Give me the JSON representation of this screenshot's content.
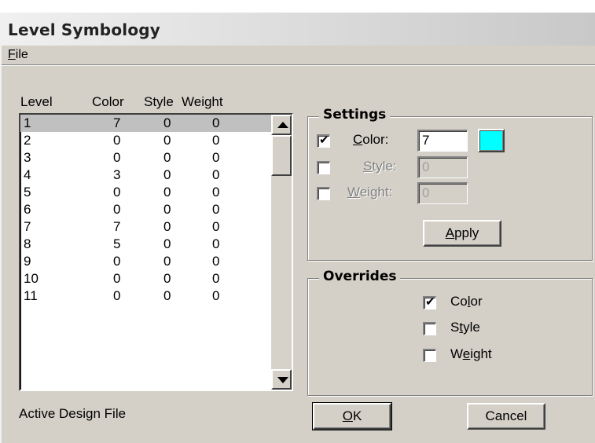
{
  "window": {
    "title": "Level Symbology"
  },
  "menu": {
    "file_prefix": "",
    "file_accel": "F",
    "file_rest": "ile"
  },
  "list": {
    "headers": {
      "level": "Level",
      "color": "Color",
      "style": "Style",
      "weight": "Weight"
    },
    "rows": [
      {
        "level": "1",
        "color": "7",
        "style": "0",
        "weight": "0"
      },
      {
        "level": "2",
        "color": "0",
        "style": "0",
        "weight": "0"
      },
      {
        "level": "3",
        "color": "0",
        "style": "0",
        "weight": "0"
      },
      {
        "level": "4",
        "color": "3",
        "style": "0",
        "weight": "0"
      },
      {
        "level": "5",
        "color": "0",
        "style": "0",
        "weight": "0"
      },
      {
        "level": "6",
        "color": "0",
        "style": "0",
        "weight": "0"
      },
      {
        "level": "7",
        "color": "7",
        "style": "0",
        "weight": "0"
      },
      {
        "level": "8",
        "color": "5",
        "style": "0",
        "weight": "0"
      },
      {
        "level": "9",
        "color": "0",
        "style": "0",
        "weight": "0"
      },
      {
        "level": "10",
        "color": "0",
        "style": "0",
        "weight": "0"
      },
      {
        "level": "11",
        "color": "0",
        "style": "0",
        "weight": "0"
      }
    ],
    "selected_index": 0
  },
  "settings": {
    "title": "Settings",
    "color": {
      "accel": "C",
      "rest": "olor:",
      "value": "7",
      "checked": true,
      "swatch": "#00ffff"
    },
    "style": {
      "accel": "S",
      "rest": "tyle:",
      "value": "0",
      "checked": false
    },
    "weight": {
      "accel": "W",
      "rest": "eight:",
      "value": "0",
      "checked": false
    },
    "apply": {
      "accel": "A",
      "rest": "pply"
    }
  },
  "overrides": {
    "title": "Overrides",
    "color": {
      "pre": "Co",
      "accel": "l",
      "rest": "or",
      "checked": true
    },
    "style": {
      "pre": "S",
      "accel": "t",
      "rest": "yle",
      "checked": false
    },
    "weight": {
      "pre": "W",
      "accel": "e",
      "rest": "ight",
      "checked": false
    }
  },
  "footer": {
    "status": "Active Design File",
    "ok": {
      "accel": "O",
      "rest": "K"
    },
    "cancel": "Cancel"
  },
  "colors": {
    "face": "#d4d0c8",
    "selection": "#c0c0c0",
    "swatch": "#00ffff"
  }
}
